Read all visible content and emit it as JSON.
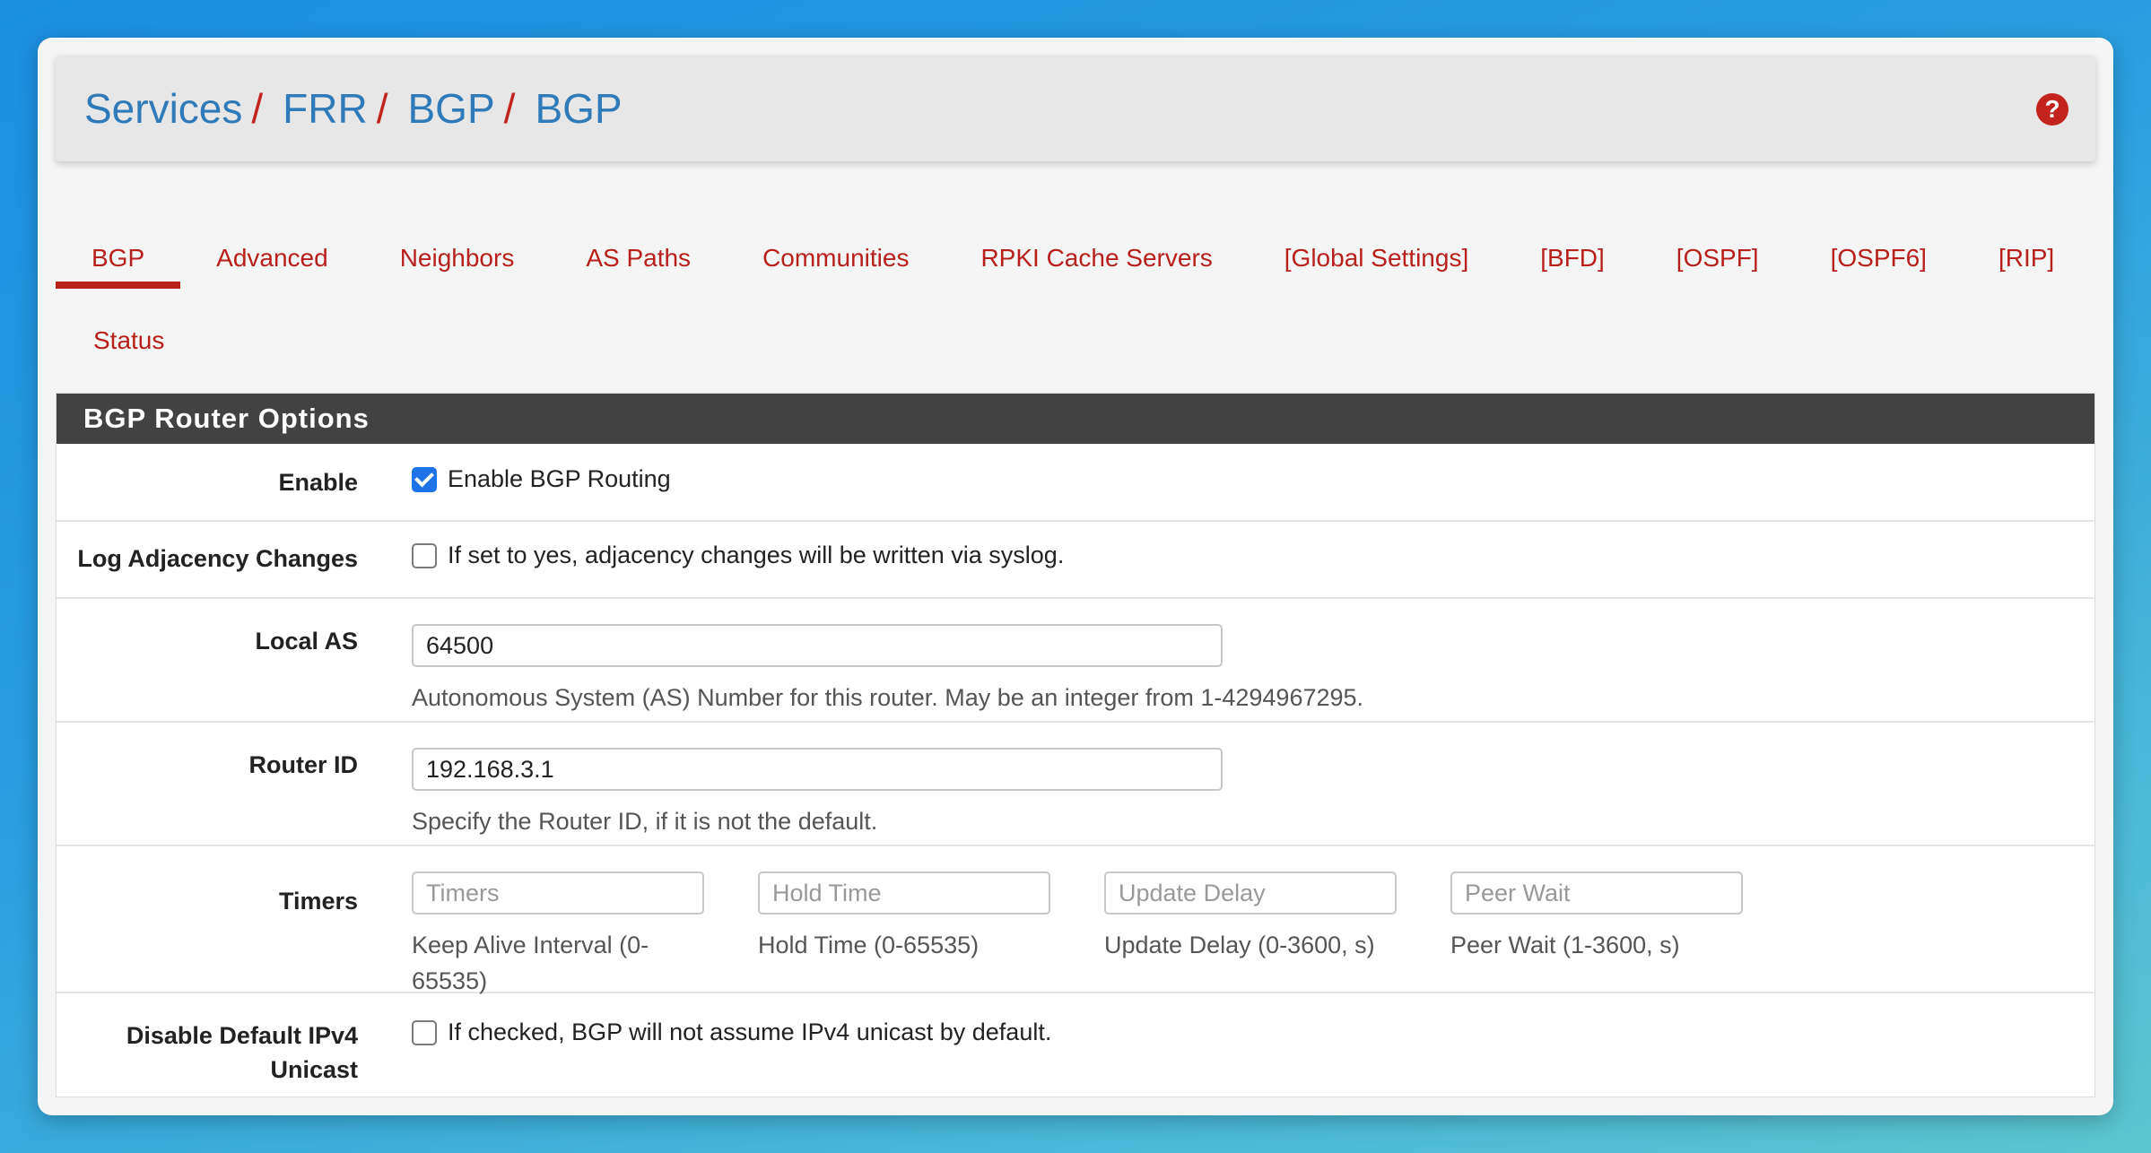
{
  "breadcrumb": [
    "Services",
    "FRR",
    "BGP",
    "BGP"
  ],
  "help_icon": "question-circle-icon",
  "tabs": [
    {
      "label": "BGP",
      "active": true
    },
    {
      "label": "Advanced"
    },
    {
      "label": "Neighbors"
    },
    {
      "label": "AS Paths"
    },
    {
      "label": "Communities"
    },
    {
      "label": "RPKI Cache Servers"
    },
    {
      "label": "[Global Settings]"
    },
    {
      "label": "[BFD]"
    },
    {
      "label": "[OSPF]"
    },
    {
      "label": "[OSPF6]"
    },
    {
      "label": "[RIP]"
    },
    {
      "label": "Status"
    }
  ],
  "panel": {
    "title": "BGP Router Options",
    "enable": {
      "label": "Enable",
      "text": "Enable BGP Routing",
      "checked": true
    },
    "log_adjacency": {
      "label": "Log Adjacency Changes",
      "text": "If set to yes, adjacency changes will be written via syslog.",
      "checked": false
    },
    "local_as": {
      "label": "Local AS",
      "value": "64500",
      "help": "Autonomous System (AS) Number for this router. May be an integer from 1-4294967295."
    },
    "router_id": {
      "label": "Router ID",
      "value": "192.168.3.1",
      "help": "Specify the Router ID, if it is not the default."
    },
    "timers": {
      "label": "Timers",
      "fields": [
        {
          "placeholder": "Timers",
          "help": "Keep Alive Interval (0-65535)"
        },
        {
          "placeholder": "Hold Time",
          "help": "Hold Time (0-65535)"
        },
        {
          "placeholder": "Update Delay",
          "help": "Update Delay (0-3600, s)"
        },
        {
          "placeholder": "Peer Wait",
          "help": "Peer Wait (1-3600, s)"
        }
      ]
    },
    "disable_ipv4": {
      "label": "Disable Default IPv4 Unicast",
      "text": "If checked, BGP will not assume IPv4 unicast by default.",
      "checked": false
    }
  },
  "colors": {
    "link_blue": "#2f7ab8",
    "tab_red": "#b8201b",
    "panel_header": "#424242",
    "checkbox_blue": "#1e73e8"
  }
}
